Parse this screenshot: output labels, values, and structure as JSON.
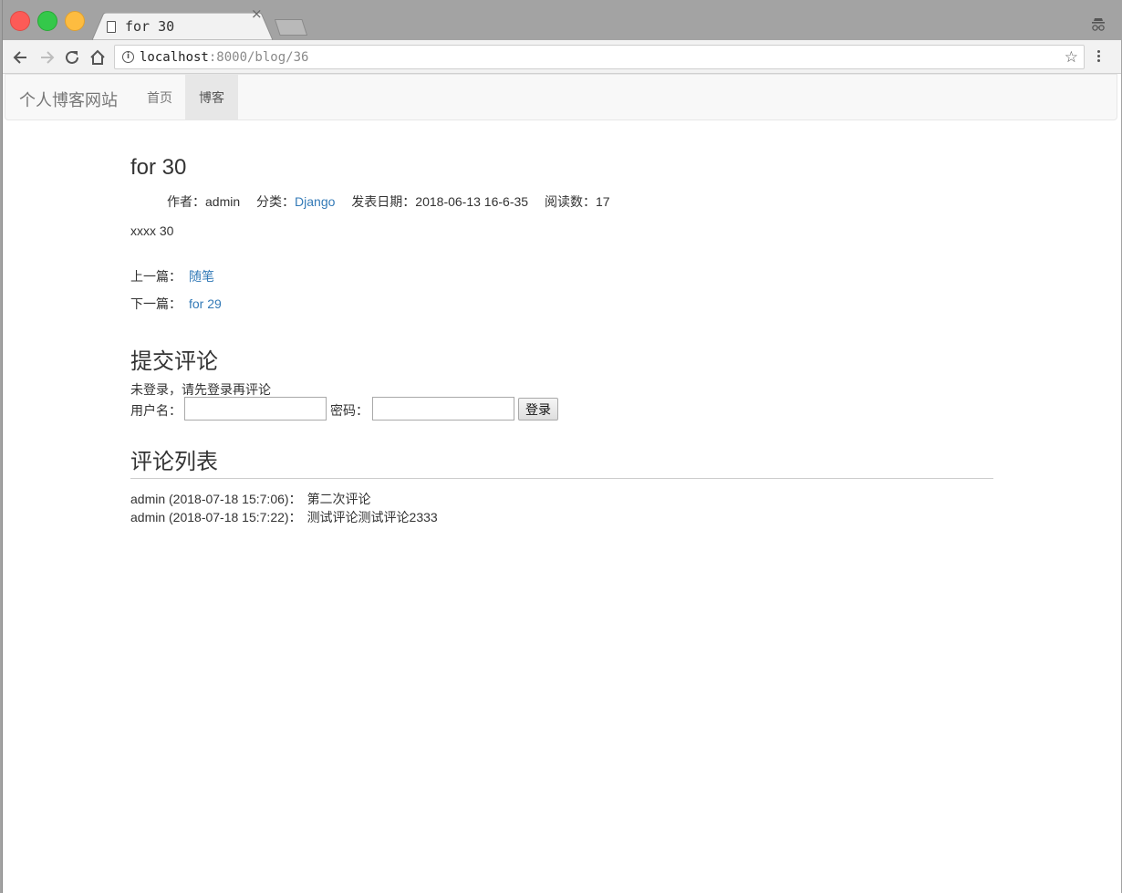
{
  "browser": {
    "tab_title": "for 30",
    "tab_close": "×",
    "url_host": "localhost",
    "url_path": ":8000/blog/36",
    "info_glyph": "i",
    "star_glyph": "☆"
  },
  "navbar": {
    "brand": "个人博客网站",
    "items": [
      {
        "label": "首页",
        "active": false
      },
      {
        "label": "博客",
        "active": true
      }
    ]
  },
  "post": {
    "title": "for 30",
    "author_label": "作者：admin",
    "category_prefix": "分类：",
    "category": "Django",
    "date_label": "发表日期：2018-06-13 16-6-35",
    "reads_label": "阅读数：17",
    "body": "xxxx 30",
    "prev_label": "上一篇：",
    "prev_link": "随笔",
    "next_label": "下一篇：",
    "next_link": "for 29"
  },
  "comment_form": {
    "heading": "提交评论",
    "login_hint": "未登录，请先登录再评论",
    "username_label": "用户名：",
    "password_label": "密码：",
    "username_value": "",
    "password_value": "",
    "submit_label": "登录"
  },
  "comment_list": {
    "heading": "评论列表",
    "comments": [
      {
        "meta": "admin (2018-07-18 15:7:06)：",
        "text": "第二次评论"
      },
      {
        "meta": "admin (2018-07-18 15:7:22)：",
        "text": "测试评论测试评论2333"
      }
    ]
  },
  "colors": {
    "link": "#337ab7",
    "navbar_bg": "#f8f8f8",
    "nav_active_bg": "#e7e7e7"
  }
}
